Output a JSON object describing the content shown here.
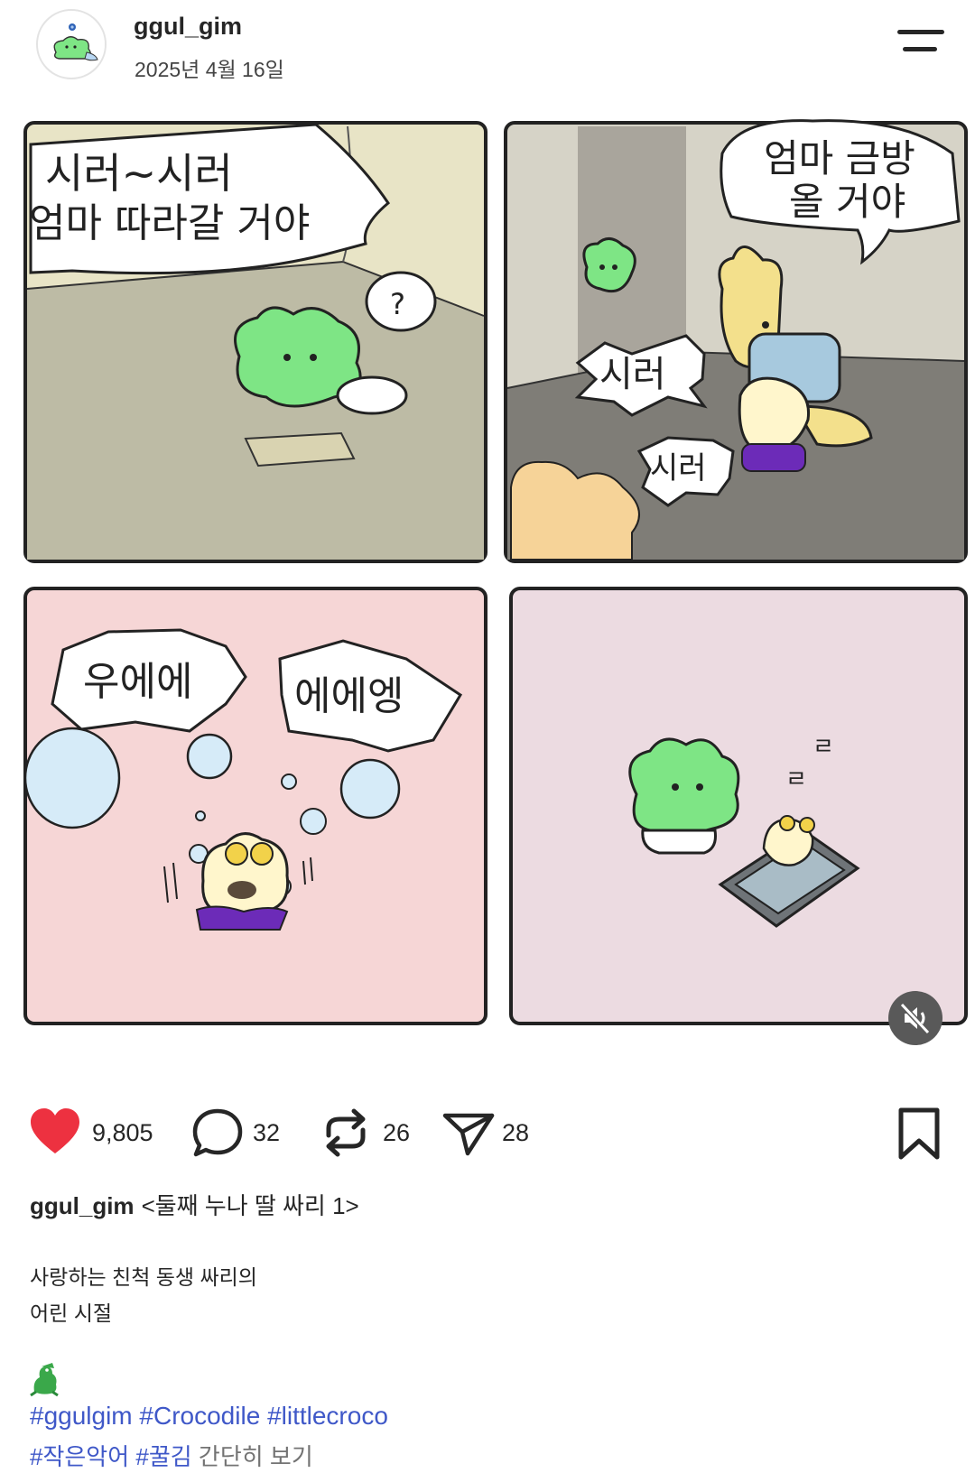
{
  "post": {
    "username": "ggul_gim",
    "date": "2025년 4월 16일"
  },
  "comic": {
    "panel1": {
      "bubble_line1": "시러~시러",
      "bubble_line2": "엄마 따라갈 거야",
      "question_mark": "?"
    },
    "panel2": {
      "bubble_line1": "엄마 금방",
      "bubble_line2": "올 거야",
      "shout1": "시러",
      "shout2": "시러"
    },
    "panel3": {
      "shout1": "우에에",
      "shout2": "에에엥"
    },
    "panel4": {
      "snore": "ㄹ"
    },
    "colors": {
      "panel_gray": "#bdbba5",
      "panel_pink": "#f6d6d6",
      "panel_mauve": "#ecdbe1",
      "croc_green": "#7ee585"
    }
  },
  "actions": {
    "likes": "9,805",
    "comments": "32",
    "reposts": "26",
    "shares": "28",
    "like_icon": "heart-icon",
    "like_color": "#ed3140"
  },
  "caption": {
    "username": "ggul_gim",
    "title": "<둘째 누나 딸 싸리 1>",
    "line1": "사랑하는 친척 동생 싸리의",
    "line2": "어린 시절",
    "emoji": "crocodile-icon",
    "tags_line1": [
      "#ggulgim",
      "#Crocodile",
      "#littlecroco"
    ],
    "tags_line2": [
      "#작은악어",
      "#꿀김"
    ],
    "more": "간단히 보기",
    "tag_color": "#3f58c8"
  }
}
